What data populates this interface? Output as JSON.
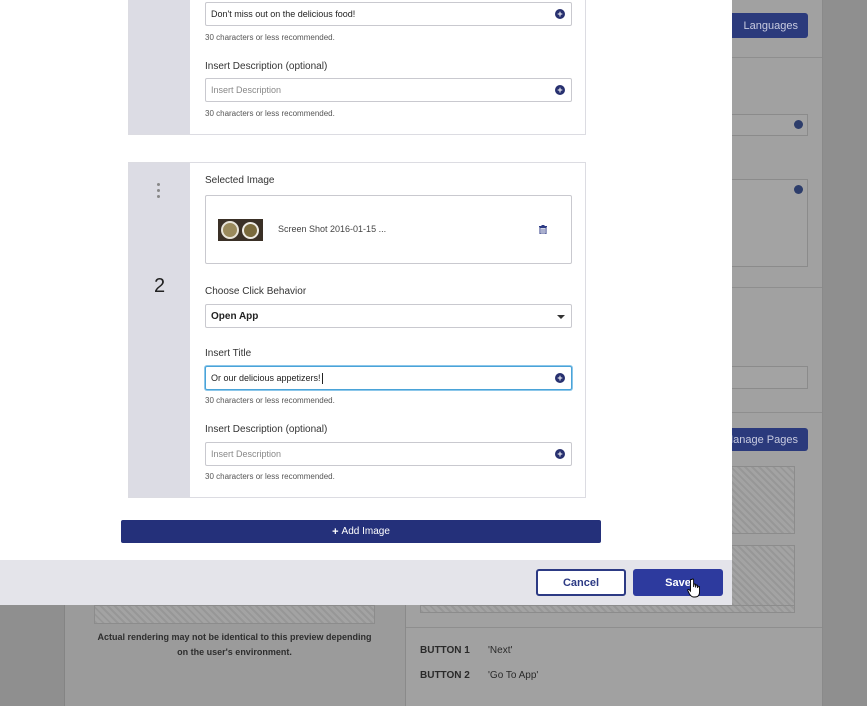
{
  "background": {
    "languages_button": "Languages",
    "manage_pages_button": "Manage Pages",
    "preview_caption": "Actual rendering may not be identical to this preview depending on the user's environment.",
    "buttons": [
      {
        "key": "BUTTON 1",
        "value": "'Next'"
      },
      {
        "key": "BUTTON 2",
        "value": "'Go To App'"
      }
    ]
  },
  "slide1": {
    "title_value": "Don't miss out on the delicious food!",
    "title_hint": "30 characters or less recommended.",
    "description_label": "Insert Description (optional)",
    "description_placeholder": "Insert Description",
    "description_hint": "30 characters or less recommended."
  },
  "slide2": {
    "number": "2",
    "selected_image_label": "Selected Image",
    "file_name": "Screen Shot 2016-01-15 ...",
    "click_behavior_label": "Choose Click Behavior",
    "click_behavior_value": "Open App",
    "title_label": "Insert Title",
    "title_value": "Or our delicious appetizers!",
    "title_hint": "30 characters or less recommended.",
    "description_label": "Insert Description (optional)",
    "description_placeholder": "Insert Description",
    "description_hint": "30 characters or less recommended."
  },
  "add_image_label": "Add Image",
  "footer": {
    "cancel_label": "Cancel",
    "save_label": "Save"
  },
  "icons": {
    "plus": "+",
    "add": "+"
  },
  "colors": {
    "primary": "#2d3a9e",
    "add_button": "#24307a",
    "focus": "#4aa3d8",
    "rail": "#dcdce4"
  }
}
